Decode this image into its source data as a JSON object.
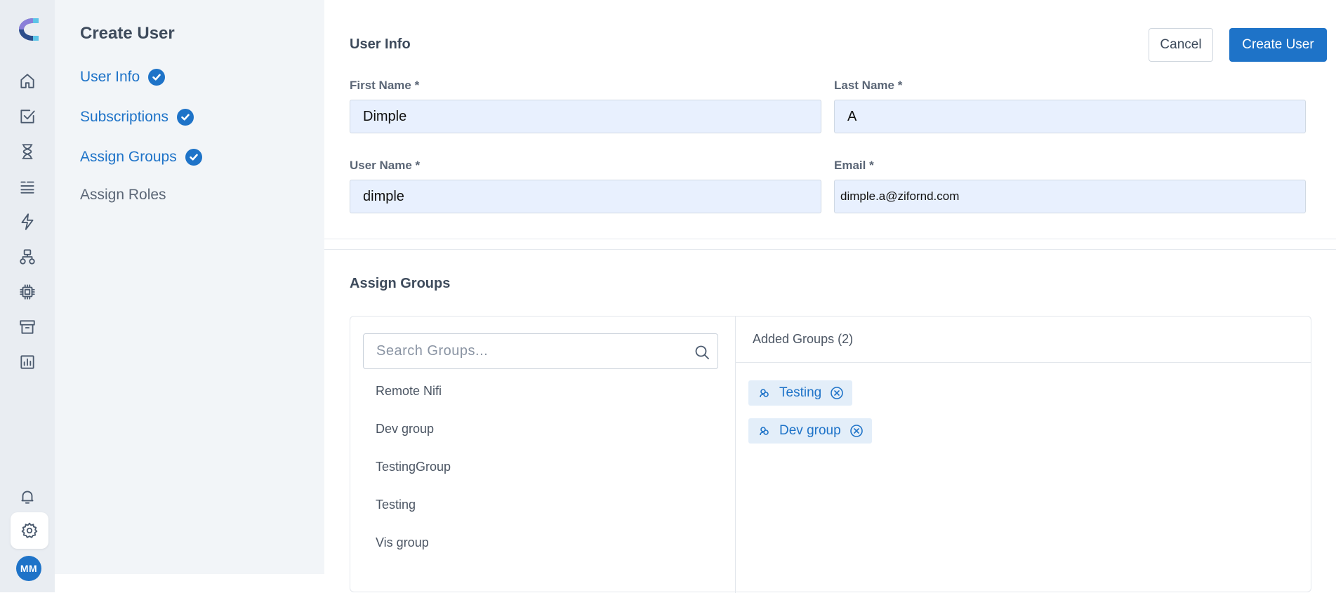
{
  "page_title": "Create User",
  "steps": [
    {
      "label": "User Info",
      "done": true
    },
    {
      "label": "Subscriptions",
      "done": true
    },
    {
      "label": "Assign Groups",
      "done": true
    },
    {
      "label": "Assign Roles",
      "done": false
    }
  ],
  "rail": {
    "icons": [
      "home-icon",
      "task-check-icon",
      "hourglass-icon",
      "list-icon",
      "lightning-icon",
      "hierarchy-icon",
      "chip-icon",
      "archive-icon",
      "chart-icon",
      "bell-icon",
      "gear-icon"
    ],
    "active": "gear-icon",
    "avatar_initials": "MM"
  },
  "user_info": {
    "title": "User Info",
    "cancel_label": "Cancel",
    "create_label": "Create User",
    "first_name": {
      "label": "First Name *",
      "value": "Dimple"
    },
    "last_name": {
      "label": "Last Name *",
      "value": "A"
    },
    "user_name": {
      "label": "User Name *",
      "value": "dimple"
    },
    "email": {
      "label": "Email *",
      "value": "dimple.a@zifornd.com"
    }
  },
  "assign_groups": {
    "title": "Assign Groups",
    "search_placeholder": "Search Groups...",
    "available": [
      "Remote Nifi",
      "Dev group",
      "TestingGroup",
      "Testing",
      "Vis group"
    ],
    "added_header": "Added Groups (2)",
    "added": [
      "Testing",
      "Dev group"
    ]
  },
  "colors": {
    "accent": "#1e73c8",
    "rail_bg": "#e9edf2",
    "steps_bg": "#f2f5f8",
    "field_bg": "#e8f0fe",
    "chip_bg": "#e3eef9"
  }
}
